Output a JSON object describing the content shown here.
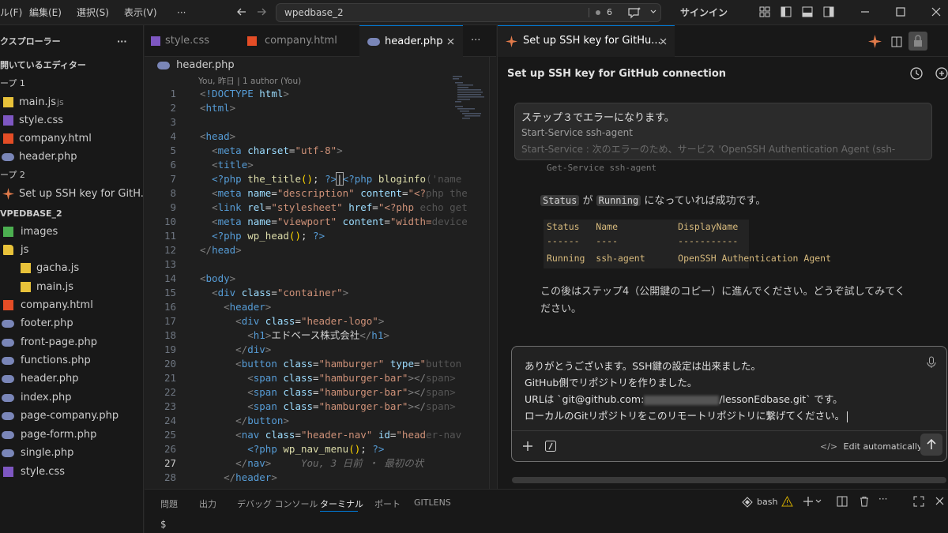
{
  "titlebar": {
    "menu": [
      "ル(F)",
      "編集(E)",
      "選択(S)",
      "表示(V)",
      "···"
    ],
    "search_text": "wpedbase_2",
    "badge_count": "6",
    "signin_label": "サインイン"
  },
  "sidebar": {
    "explorer_title": "クスプローラー",
    "more": "···",
    "open_editors_title": "開いているエディター",
    "group1_label": "ープ 1",
    "group1_items": [
      {
        "label": "main.js",
        "suffix": "js"
      },
      {
        "label": "style.css"
      },
      {
        "label": "company.html"
      },
      {
        "label": "header.php"
      }
    ],
    "group2_label": "ープ 2",
    "group2_items": [
      {
        "label": "Set up SSH key for GitH..."
      }
    ],
    "workspace_title": "VPEDBASE_2",
    "tree": {
      "images": "images",
      "js": "js",
      "gacha": "gacha.js",
      "main": "main.js",
      "company": "company.html",
      "footer": "footer.php",
      "front_page": "front-page.php",
      "functions": "functions.php",
      "header": "header.php",
      "index": "index.php",
      "page_company": "page-company.php",
      "page_form": "page-form.php",
      "single": "single.php",
      "style": "style.css"
    }
  },
  "editor": {
    "tabs": [
      "style.css",
      "company.html",
      "header.php"
    ],
    "tab_more": "···",
    "breadcrumb": "header.php",
    "blame": "You, 昨日 | 1 author (You)",
    "ghost_text": "You, 3 日前 ・ 最初の状"
  },
  "panel": {
    "tabs": [
      "問題",
      "出力",
      "デバッグ コンソール",
      "ターミナル",
      "ポート",
      "GITLENS"
    ],
    "shell_label": "bash",
    "prompt": "$"
  },
  "chat": {
    "tab_title": "Set up SSH key for GitHu...",
    "header_title": "Set up SSH key for GitHub connection",
    "user_msg": {
      "line1": "ステップ３でエラーになります。",
      "line2": "Start-Service ssh-agent",
      "line3": "Start-Service : 次のエラーのため、サービス 'OpenSSH Authentication Agent (ssh-"
    },
    "cut_code": "Get-Service ssh-agent",
    "status_sentence": {
      "code1": "Status",
      "mid": " が ",
      "code2": "Running",
      "end": " になっていれば成功です。"
    },
    "table": {
      "header": "Status   Name           DisplayName",
      "rule": "------   ----           -----------",
      "row": "Running  ssh-agent      OpenSSH Authentication Agent"
    },
    "next_line1": "この後はステップ4（公開鍵のコピー）に進んでください。どうぞ試してみてく",
    "next_line2": "ださい。",
    "input_lines": [
      "ありがとうございます。SSH鍵の設定は出来ました。",
      "GitHub側でリポジトリを作りました。",
      "URLは `git@github.com:",
      "/lessonEdbase.git` です。",
      "ローカルのGitリポジトリをこのリモートリポジトリに繋げてください。"
    ],
    "edit_label": "Edit automatically"
  },
  "colors": {
    "accent": "#0078d4",
    "bg": "#1f1f1f",
    "sidebar": "#181818"
  }
}
